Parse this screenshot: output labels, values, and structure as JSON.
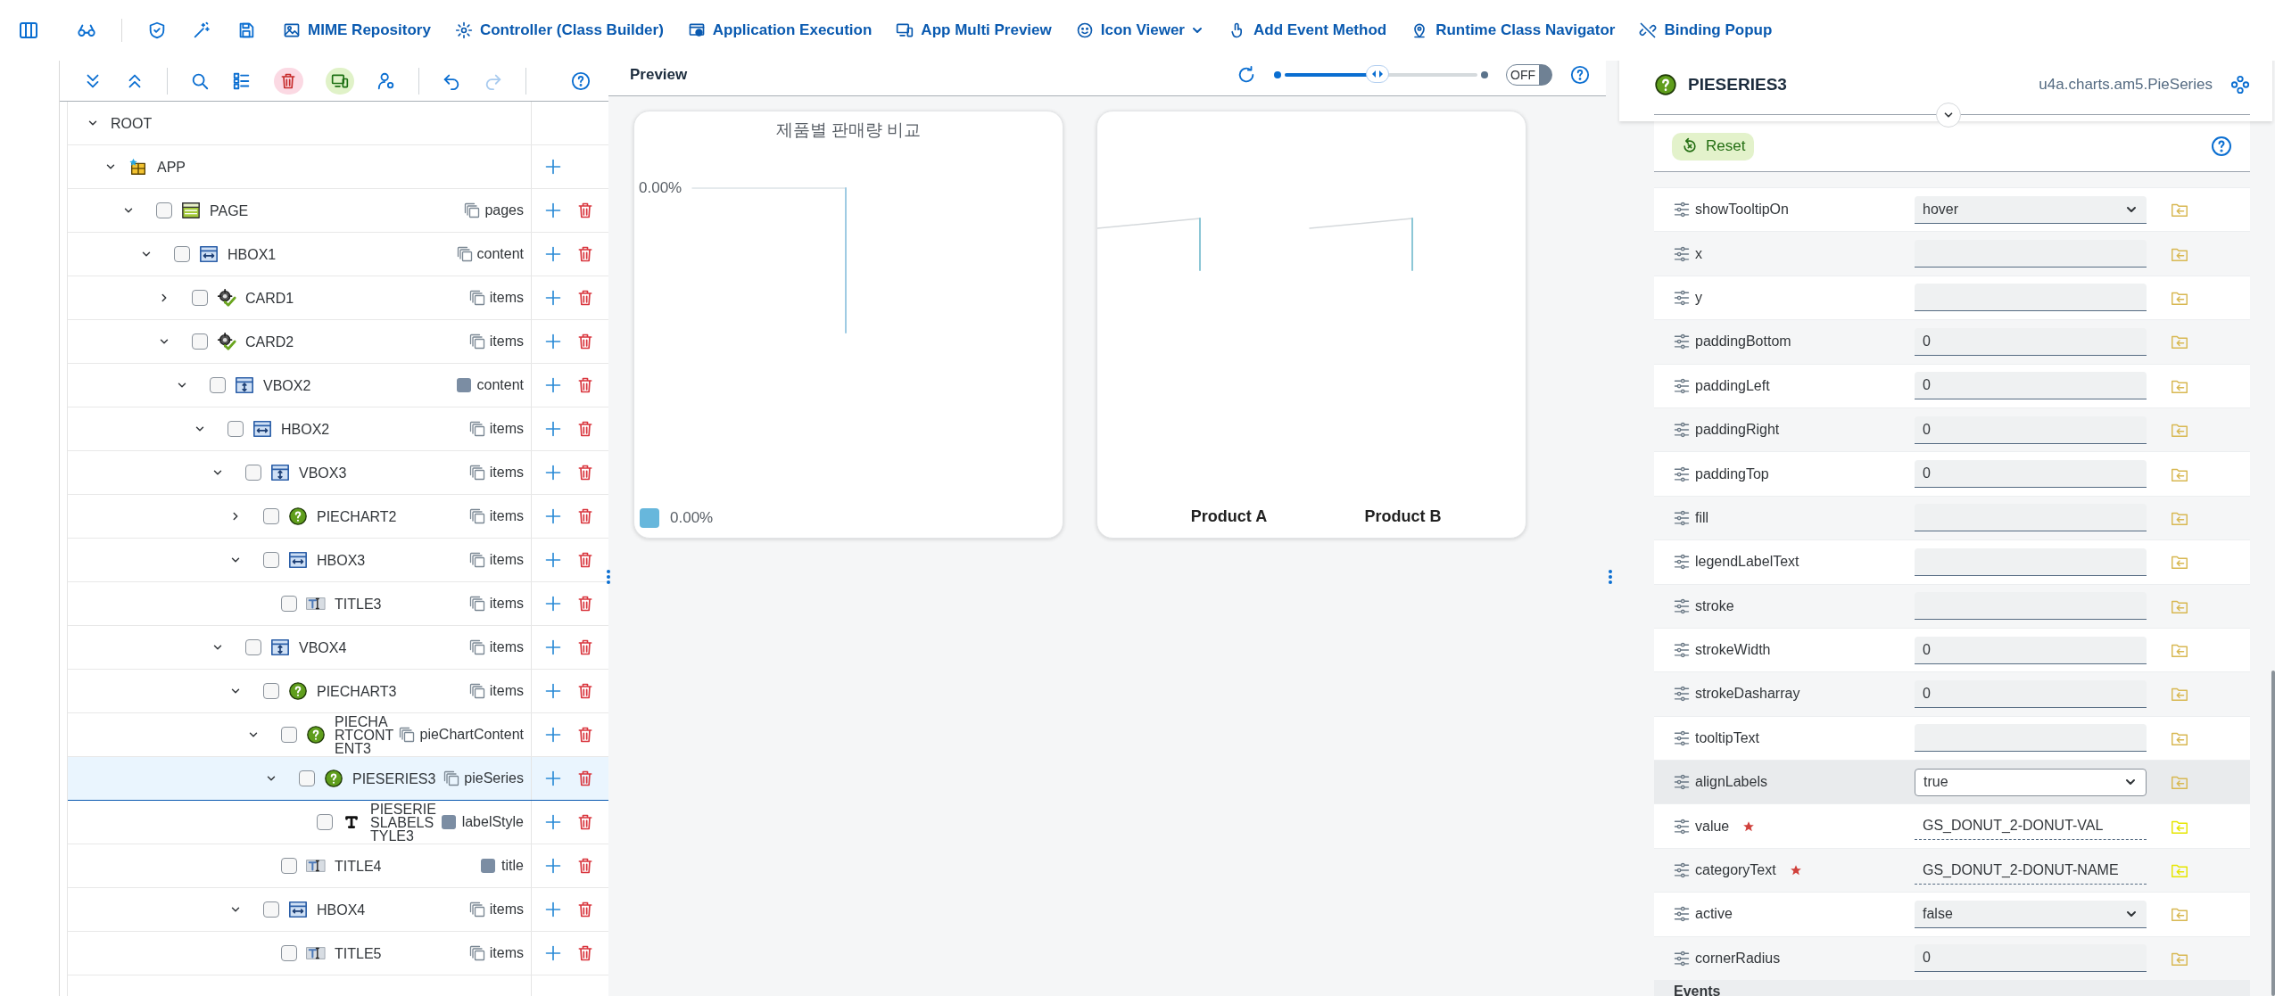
{
  "toolbar": [
    {
      "label": "MIME Repository",
      "has_menu": false
    },
    {
      "label": "Controller (Class Builder)",
      "has_menu": false
    },
    {
      "label": "Application Execution",
      "has_menu": false
    },
    {
      "label": "App Multi Preview",
      "has_menu": false
    },
    {
      "label": "Icon Viewer",
      "has_menu": true
    },
    {
      "label": "Add Event Method",
      "has_menu": false
    },
    {
      "label": "Runtime Class Navigator",
      "has_menu": false
    },
    {
      "label": "Binding Popup",
      "has_menu": false
    }
  ],
  "tree_toolbar": [
    {
      "disabled": false
    },
    {
      "disabled": false
    },
    {
      "disabled": false
    },
    {
      "disabled": false
    },
    {
      "disabled": false
    },
    {
      "disabled": false
    },
    {
      "disabled": false
    },
    {
      "disabled": false
    },
    {
      "disabled": true
    },
    {
      "disabled": false
    }
  ],
  "tree": [
    {
      "name": "ROOT",
      "kind": "root",
      "expanded": true,
      "selected": false,
      "children": [
        {
          "name": "APP",
          "kind": "app",
          "expanded": true,
          "selected": false,
          "children": [
            {
              "name": "PAGE",
              "kind": "page",
              "expanded": true,
              "checked": false,
              "selected": false,
              "aggregation": "pages",
              "multiple": true,
              "children": [
                {
                  "name": "HBOX1",
                  "kind": "hbox",
                  "expanded": true,
                  "checked": false,
                  "selected": false,
                  "aggregation": "content",
                  "multiple": true,
                  "children": [
                    {
                      "name": "CARD1",
                      "kind": "card",
                      "expanded": false,
                      "checked": false,
                      "selected": false,
                      "aggregation": "items",
                      "multiple": true
                    },
                    {
                      "name": "CARD2",
                      "kind": "card",
                      "expanded": true,
                      "checked": false,
                      "selected": false,
                      "aggregation": "items",
                      "multiple": true,
                      "children": [
                        {
                          "name": "VBOX2",
                          "kind": "vbox",
                          "expanded": true,
                          "checked": false,
                          "selected": false,
                          "aggregation": "content",
                          "multiple": false,
                          "children": [
                            {
                              "name": "HBOX2",
                              "kind": "hbox",
                              "expanded": true,
                              "checked": false,
                              "selected": false,
                              "aggregation": "items",
                              "multiple": true,
                              "children": [
                                {
                                  "name": "VBOX3",
                                  "kind": "vbox",
                                  "expanded": true,
                                  "checked": false,
                                  "selected": false,
                                  "aggregation": "items",
                                  "multiple": true,
                                  "children": [
                                    {
                                      "name": "PIECHART2",
                                      "kind": "pie",
                                      "expanded": false,
                                      "checked": false,
                                      "selected": false,
                                      "aggregation": "items",
                                      "multiple": true
                                    },
                                    {
                                      "name": "HBOX3",
                                      "kind": "hbox",
                                      "expanded": true,
                                      "checked": false,
                                      "selected": false,
                                      "aggregation": "items",
                                      "multiple": true,
                                      "children": [
                                        {
                                          "name": "TITLE3",
                                          "kind": "title",
                                          "checked": false,
                                          "selected": false,
                                          "aggregation": "items",
                                          "multiple": true
                                        }
                                      ]
                                    }
                                  ]
                                },
                                {
                                  "name": "VBOX4",
                                  "kind": "vbox",
                                  "expanded": true,
                                  "checked": false,
                                  "selected": false,
                                  "aggregation": "items",
                                  "multiple": true,
                                  "children": [
                                    {
                                      "name": "PIECHART3",
                                      "kind": "pie",
                                      "expanded": true,
                                      "checked": false,
                                      "selected": false,
                                      "aggregation": "items",
                                      "multiple": true,
                                      "children": [
                                        {
                                          "name": "PIECHARTCONTENT3",
                                          "kind": "pie",
                                          "expanded": true,
                                          "checked": false,
                                          "selected": false,
                                          "aggregation": "pieChartContent",
                                          "multiple": true,
                                          "children": [
                                            {
                                              "name": "PIESERIES3",
                                              "kind": "pie",
                                              "expanded": true,
                                              "checked": false,
                                              "selected": true,
                                              "aggregation": "pieSeries",
                                              "multiple": true,
                                              "children": [
                                                {
                                                  "name": "PIESERIESLABELSTYLE3",
                                                  "kind": "text",
                                                  "checked": false,
                                                  "selected": false,
                                                  "aggregation": "labelStyle",
                                                  "multiple": false
                                                }
                                              ]
                                            }
                                          ]
                                        },
                                        {
                                          "name": "TITLE4",
                                          "kind": "title",
                                          "checked": false,
                                          "selected": false,
                                          "aggregation": "title",
                                          "multiple": false
                                        }
                                      ]
                                    },
                                    {
                                      "name": "HBOX4",
                                      "kind": "hbox",
                                      "expanded": true,
                                      "checked": false,
                                      "selected": false,
                                      "aggregation": "items",
                                      "multiple": true,
                                      "children": [
                                        {
                                          "name": "TITLE5",
                                          "kind": "title",
                                          "checked": false,
                                          "selected": false,
                                          "aggregation": "items",
                                          "multiple": true
                                        }
                                      ]
                                    }
                                  ]
                                }
                              ]
                            }
                          ]
                        }
                      ]
                    }
                  ]
                }
              ]
            }
          ]
        }
      ]
    }
  ],
  "preview": {
    "title": "Preview",
    "zoom": {
      "level": 0.48
    },
    "toggle": {
      "label": "OFF",
      "on": false
    },
    "cards": [
      {
        "kind": "pie",
        "title": "제품별 판매량 비교",
        "label": "0.00%",
        "legend": [
          {
            "label": "0.00%",
            "color": "#67b7dc"
          }
        ]
      },
      {
        "kind": "categories",
        "labels": [
          "Product A",
          "Product B"
        ]
      }
    ]
  },
  "properties": {
    "title": "PIESERIES3",
    "class_name": "u4a.charts.am5.PieSeries",
    "reset": "Reset",
    "events": "Events",
    "rows": [
      {
        "name": "showTooltipOn",
        "kind": "select",
        "value": "hover",
        "bound": false,
        "required": false,
        "selected": false
      },
      {
        "name": "x",
        "kind": "input",
        "bound": false,
        "required": false,
        "selected": false
      },
      {
        "name": "y",
        "kind": "input",
        "bound": false,
        "required": false,
        "selected": false
      },
      {
        "name": "paddingBottom",
        "kind": "input",
        "value": "0",
        "bound": false,
        "required": false,
        "selected": false
      },
      {
        "name": "paddingLeft",
        "kind": "input",
        "value": "0",
        "bound": false,
        "required": false,
        "selected": false
      },
      {
        "name": "paddingRight",
        "kind": "input",
        "value": "0",
        "bound": false,
        "required": false,
        "selected": false
      },
      {
        "name": "paddingTop",
        "kind": "input",
        "value": "0",
        "bound": false,
        "required": false,
        "selected": false
      },
      {
        "name": "fill",
        "kind": "input",
        "bound": false,
        "required": false,
        "selected": false
      },
      {
        "name": "legendLabelText",
        "kind": "input",
        "bound": false,
        "required": false,
        "selected": false
      },
      {
        "name": "stroke",
        "kind": "input",
        "bound": false,
        "required": false,
        "selected": false
      },
      {
        "name": "strokeWidth",
        "kind": "input",
        "value": "0",
        "bound": false,
        "required": false,
        "selected": false
      },
      {
        "name": "strokeDasharray",
        "kind": "input",
        "value": "0",
        "bound": false,
        "required": false,
        "selected": false
      },
      {
        "name": "tooltipText",
        "kind": "input",
        "bound": false,
        "required": false,
        "selected": false
      },
      {
        "name": "alignLabels",
        "kind": "select",
        "value": "true",
        "bound": false,
        "required": false,
        "selected": true
      },
      {
        "name": "value",
        "kind": "input",
        "value": "GS_DONUT_2-DONUT-VAL",
        "bound": true,
        "required": true,
        "selected": false
      },
      {
        "name": "categoryText",
        "kind": "input",
        "value": "GS_DONUT_2-DONUT-NAME",
        "bound": true,
        "required": true,
        "selected": false
      },
      {
        "name": "active",
        "kind": "select",
        "value": "false",
        "bound": false,
        "required": false,
        "selected": false
      },
      {
        "name": "cornerRadius",
        "kind": "input",
        "value": "0",
        "bound": false,
        "required": false,
        "selected": false
      }
    ]
  }
}
